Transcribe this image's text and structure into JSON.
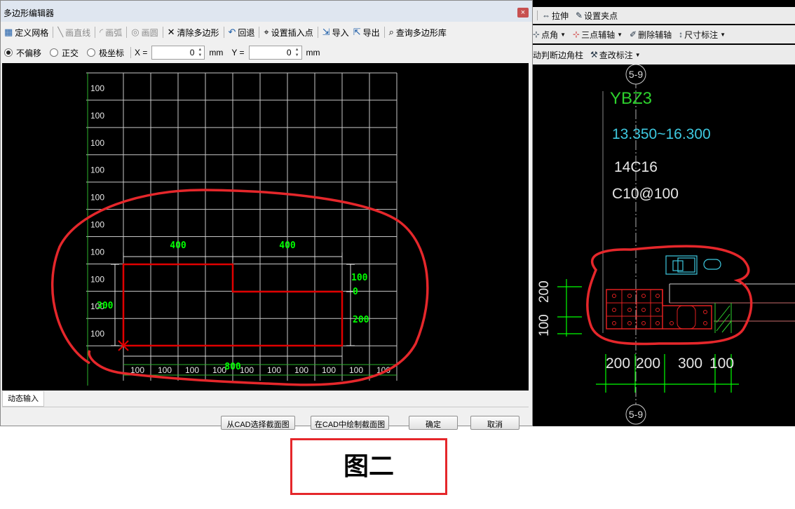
{
  "dialog": {
    "title": "多边形编辑器",
    "close": "×",
    "toolbar": [
      {
        "icon": "grid-icon",
        "glyph": "▦",
        "label": "定义网格",
        "enabled": true
      },
      {
        "icon": "line-icon",
        "glyph": "╲",
        "label": "画直线",
        "enabled": false
      },
      {
        "icon": "arc-icon",
        "glyph": "◜",
        "label": "画弧",
        "enabled": false
      },
      {
        "icon": "circle-icon",
        "glyph": "◎",
        "label": "画圆",
        "enabled": false
      },
      {
        "icon": "clear-icon",
        "glyph": "✕",
        "label": "清除多边形",
        "enabled": true
      },
      {
        "icon": "undo-icon",
        "glyph": "↶",
        "label": "回退",
        "enabled": true
      },
      {
        "icon": "insert-point-icon",
        "glyph": "⌖",
        "label": "设置插入点",
        "enabled": true
      },
      {
        "icon": "import-icon",
        "glyph": "⇲",
        "label": "导入",
        "enabled": true
      },
      {
        "icon": "export-icon",
        "glyph": "⇱",
        "label": "导出",
        "enabled": true
      },
      {
        "icon": "search-icon",
        "glyph": "⌕",
        "label": "查询多边形库",
        "enabled": true
      }
    ],
    "coords": {
      "modes": [
        {
          "label": "不偏移",
          "selected": true
        },
        {
          "label": "正交",
          "selected": false
        },
        {
          "label": "极坐标",
          "selected": false
        }
      ],
      "x_label": "X =",
      "x_value": "0",
      "x_unit": "mm",
      "y_label": "Y =",
      "y_value": "0",
      "y_unit": "mm"
    },
    "canvas": {
      "grid_row_labels": [
        "100",
        "100",
        "100",
        "100",
        "100",
        "100",
        "100",
        "100",
        "100",
        "100"
      ],
      "grid_col_labels": [
        "100",
        "100",
        "100",
        "100",
        "100",
        "100",
        "100",
        "100",
        "100",
        "100"
      ],
      "dim_top_left": "400",
      "dim_top_right": "400",
      "dim_right_upper_a": "100",
      "dim_right_upper_b": "0",
      "dim_right_lower": "200",
      "dim_left": "300",
      "dim_bottom": "800"
    },
    "tab_dynamic_input": "动态输入",
    "buttons": {
      "select_from_cad": "从CAD选择截面图",
      "draw_in_cad": "在CAD中绘制截面图",
      "ok": "确定",
      "cancel": "取消"
    }
  },
  "cad": {
    "toolbar_row1": [
      {
        "icon": "stretch-icon",
        "glyph": "⇔",
        "label": "拉伸"
      },
      {
        "icon": "grip-icon",
        "glyph": "✎",
        "label": "设置夹点"
      }
    ],
    "toolbar_row2": [
      {
        "icon": "point-angle-icon",
        "glyph": "⊹",
        "label": "点角",
        "dropdown": true
      },
      {
        "icon": "three-point-axis-icon",
        "glyph": "⊹",
        "label": "三点辅轴",
        "dropdown": true
      },
      {
        "icon": "delete-axis-icon",
        "glyph": "✐",
        "label": "删除辅轴",
        "dropdown": false
      },
      {
        "icon": "dimension-icon",
        "glyph": "↕",
        "label": "尺寸标注",
        "dropdown": true
      }
    ],
    "toolbar_row3": [
      {
        "icon": "auto-corner-icon",
        "glyph": "",
        "label": "动判断边角柱",
        "dropdown": false
      },
      {
        "icon": "check-label-icon",
        "glyph": "⚒",
        "label": "查改标注",
        "dropdown": true
      }
    ],
    "axis_top": "5-9",
    "axis_bottom": "5-9",
    "column_name": "YBZ3",
    "elevation": "13.350~16.300",
    "main_rebar": "14C16",
    "stirrup": "C10@100",
    "dim_vertical_upper": "200",
    "dim_vertical_lower": "100",
    "dim_bottom": [
      "200",
      "200",
      "300",
      "100"
    ]
  },
  "caption": "图二",
  "colors": {
    "annotation_red": "#e5272b",
    "grid_white": "#c8c8c8",
    "dim_green": "#00ff00",
    "label_green": "#2dd12d",
    "polygon_red": "#e00000",
    "cad_cyan": "#3ec9e0"
  }
}
